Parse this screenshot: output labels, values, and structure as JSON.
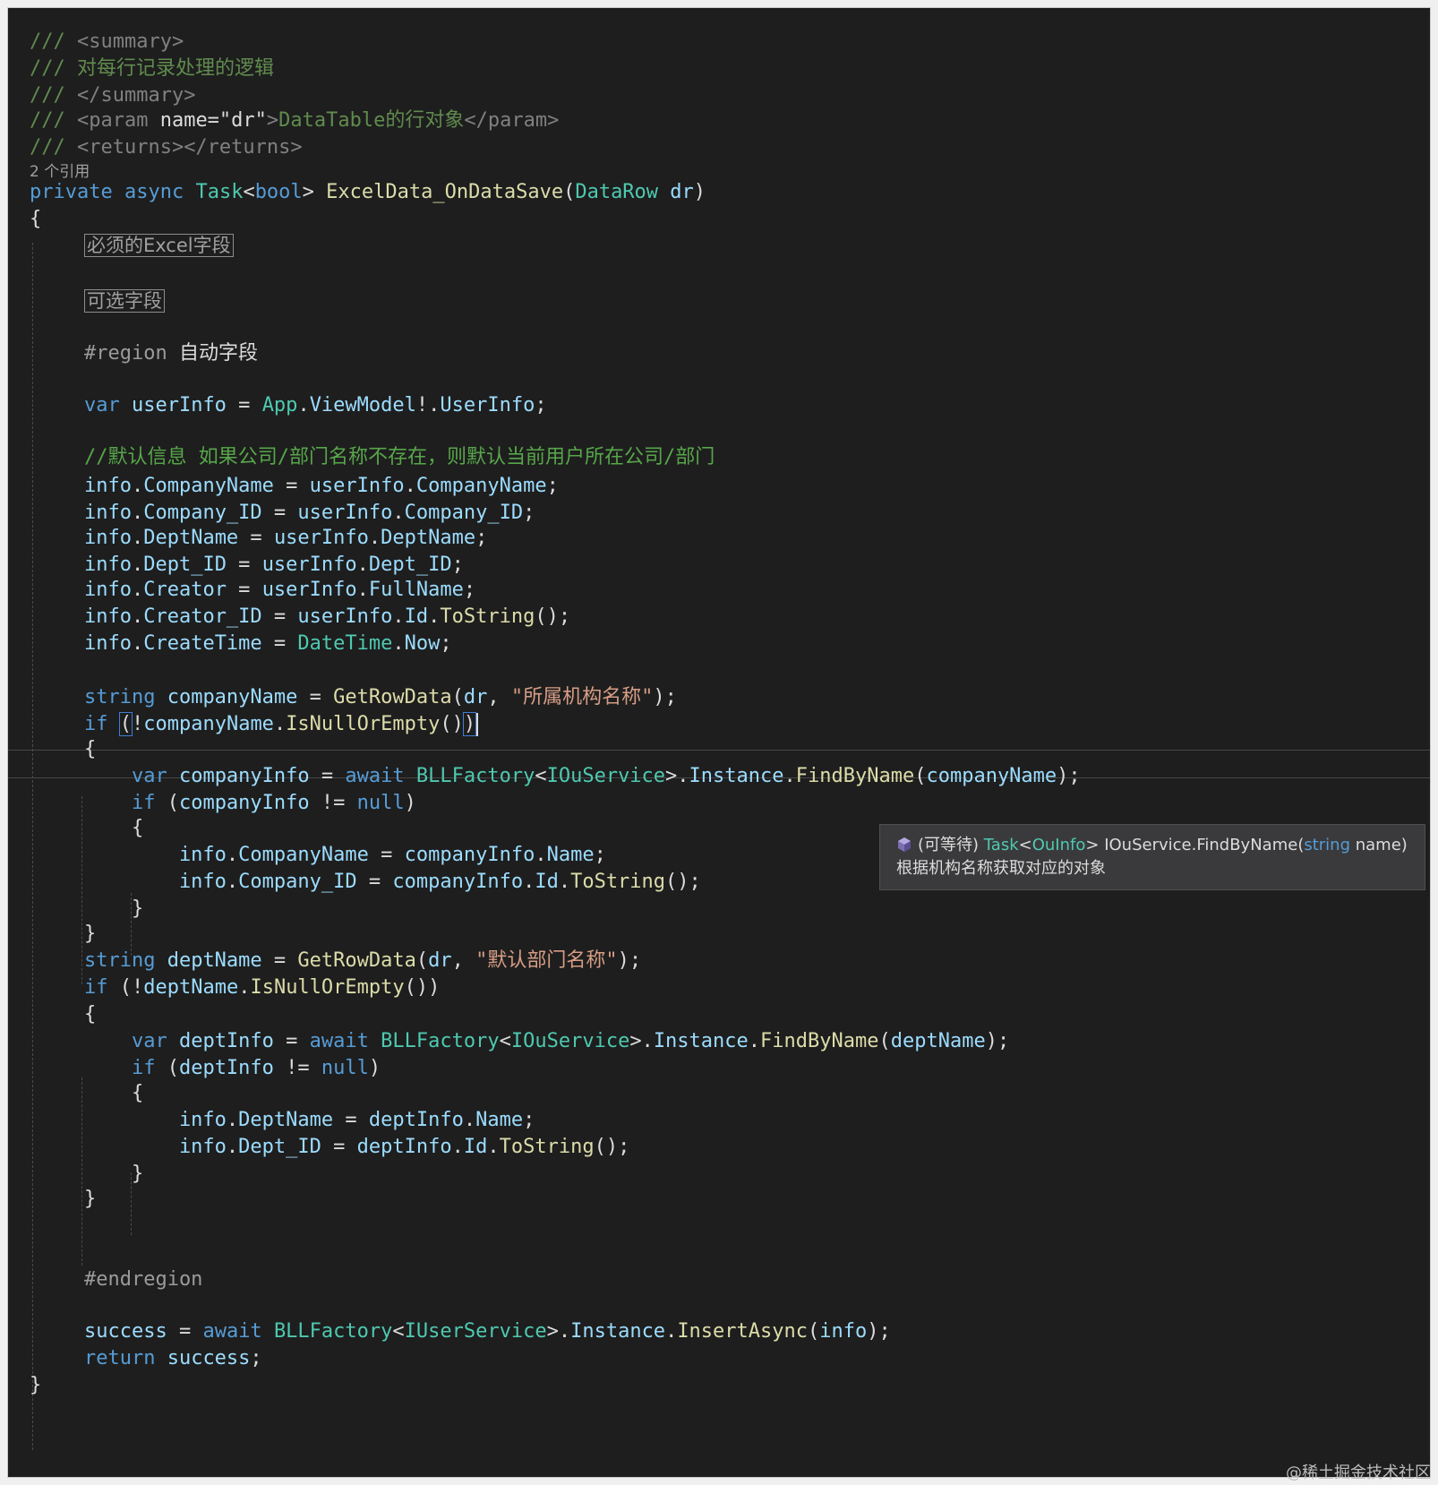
{
  "editor": {
    "codelens": "2 个引用",
    "tooltip": {
      "icon": "cube-icon",
      "prefix": "(可等待) ",
      "type": "Task",
      "lt": "<",
      "type_arg": "OuInfo",
      "gt": "> ",
      "method": "IOuService.FindByName(",
      "param_type": "string",
      "param_name": " name)",
      "description": "根据机构名称获取对应的对象"
    }
  },
  "lines": [
    [
      [
        "c-doc",
        "/// "
      ],
      [
        "c-doctag",
        "<summary>"
      ]
    ],
    [
      [
        "c-doc",
        "/// 对每行记录处理的逻辑"
      ]
    ],
    [
      [
        "c-doc",
        "/// "
      ],
      [
        "c-doctag",
        "</summary>"
      ]
    ],
    [
      [
        "c-doc",
        "/// "
      ],
      [
        "c-doctag",
        "<param "
      ],
      [
        "c-plain",
        "name=\"dr\""
      ],
      [
        "c-doctag",
        ">"
      ],
      [
        "c-doc",
        "DataTable的行对象"
      ],
      [
        "c-doctag",
        "</param>"
      ]
    ],
    [
      [
        "c-doc",
        "/// "
      ],
      [
        "c-doctag",
        "<returns></returns>"
      ]
    ],
    [
      [
        "c-kw",
        "private"
      ],
      [
        "c-plain",
        " "
      ],
      [
        "c-kw",
        "async"
      ],
      [
        "c-plain",
        " "
      ],
      [
        "c-type",
        "Task"
      ],
      [
        "c-plain",
        "<"
      ],
      [
        "c-kw",
        "bool"
      ],
      [
        "c-plain",
        "> "
      ],
      [
        "c-meth",
        "ExcelData_OnDataSave"
      ],
      [
        "c-plain",
        "("
      ],
      [
        "c-type",
        "DataRow"
      ],
      [
        "c-plain",
        " "
      ],
      [
        "c-var",
        "dr"
      ],
      [
        "c-plain",
        ")"
      ]
    ],
    [
      [
        "c-plain",
        "{"
      ]
    ],
    [
      [
        "c-plain",
        "    "
      ],
      [
        "collapsed",
        "必须的Excel字段"
      ]
    ],
    [
      [
        "c-plain",
        "    "
      ],
      [
        "collapsed",
        "可选字段"
      ]
    ],
    [
      [
        "c-pre",
        "    #region "
      ],
      [
        "c-plain",
        "自动字段"
      ]
    ],
    [
      [
        "c-kw",
        "    var"
      ],
      [
        "c-plain",
        " "
      ],
      [
        "c-var",
        "userInfo"
      ],
      [
        "c-plain",
        " = "
      ],
      [
        "c-type",
        "App"
      ],
      [
        "c-plain",
        "."
      ],
      [
        "c-var",
        "ViewModel"
      ],
      [
        "c-plain",
        "!."
      ],
      [
        "c-var",
        "UserInfo"
      ],
      [
        "c-plain",
        ";"
      ]
    ],
    [
      [
        "c-cmt",
        "    //默认信息 如果公司/部门名称不存在，则默认当前用户所在公司/部门"
      ]
    ],
    [
      [
        "c-var",
        "    info"
      ],
      [
        "c-plain",
        "."
      ],
      [
        "c-var",
        "CompanyName"
      ],
      [
        "c-plain",
        " = "
      ],
      [
        "c-var",
        "userInfo"
      ],
      [
        "c-plain",
        "."
      ],
      [
        "c-var",
        "CompanyName"
      ],
      [
        "c-plain",
        ";"
      ]
    ],
    [
      [
        "c-var",
        "    info"
      ],
      [
        "c-plain",
        "."
      ],
      [
        "c-var",
        "Company_ID"
      ],
      [
        "c-plain",
        " = "
      ],
      [
        "c-var",
        "userInfo"
      ],
      [
        "c-plain",
        "."
      ],
      [
        "c-var",
        "Company_ID"
      ],
      [
        "c-plain",
        ";"
      ]
    ],
    [
      [
        "c-var",
        "    info"
      ],
      [
        "c-plain",
        "."
      ],
      [
        "c-var",
        "DeptName"
      ],
      [
        "c-plain",
        " = "
      ],
      [
        "c-var",
        "userInfo"
      ],
      [
        "c-plain",
        "."
      ],
      [
        "c-var",
        "DeptName"
      ],
      [
        "c-plain",
        ";"
      ]
    ],
    [
      [
        "c-var",
        "    info"
      ],
      [
        "c-plain",
        "."
      ],
      [
        "c-var",
        "Dept_ID"
      ],
      [
        "c-plain",
        " = "
      ],
      [
        "c-var",
        "userInfo"
      ],
      [
        "c-plain",
        "."
      ],
      [
        "c-var",
        "Dept_ID"
      ],
      [
        "c-plain",
        ";"
      ]
    ],
    [
      [
        "c-var",
        "    info"
      ],
      [
        "c-plain",
        "."
      ],
      [
        "c-var",
        "Creator"
      ],
      [
        "c-plain",
        " = "
      ],
      [
        "c-var",
        "userInfo"
      ],
      [
        "c-plain",
        "."
      ],
      [
        "c-var",
        "FullName"
      ],
      [
        "c-plain",
        ";"
      ]
    ],
    [
      [
        "c-var",
        "    info"
      ],
      [
        "c-plain",
        "."
      ],
      [
        "c-var",
        "Creator_ID"
      ],
      [
        "c-plain",
        " = "
      ],
      [
        "c-var",
        "userInfo"
      ],
      [
        "c-plain",
        "."
      ],
      [
        "c-var",
        "Id"
      ],
      [
        "c-plain",
        "."
      ],
      [
        "c-meth",
        "ToString"
      ],
      [
        "c-plain",
        "();"
      ]
    ],
    [
      [
        "c-var",
        "    info"
      ],
      [
        "c-plain",
        "."
      ],
      [
        "c-var",
        "CreateTime"
      ],
      [
        "c-plain",
        " = "
      ],
      [
        "c-type",
        "DateTime"
      ],
      [
        "c-plain",
        "."
      ],
      [
        "c-var",
        "Now"
      ],
      [
        "c-plain",
        ";"
      ]
    ],
    [
      [
        "c-kw",
        "    string"
      ],
      [
        "c-plain",
        " "
      ],
      [
        "c-var",
        "companyName"
      ],
      [
        "c-plain",
        " = "
      ],
      [
        "c-meth",
        "GetRowData"
      ],
      [
        "c-plain",
        "("
      ],
      [
        "c-var",
        "dr"
      ],
      [
        "c-plain",
        ", "
      ],
      [
        "c-str",
        "\"所属机构名称\""
      ],
      [
        "c-plain",
        ");"
      ]
    ],
    [
      [
        "c-kw",
        "    if"
      ],
      [
        "c-plain",
        " "
      ],
      [
        "c-brace-hl",
        "("
      ],
      [
        "c-plain",
        "!"
      ],
      [
        "c-var",
        "companyName"
      ],
      [
        "c-plain",
        "."
      ],
      [
        "c-meth",
        "IsNullOrEmpty"
      ],
      [
        "c-plain",
        "()"
      ],
      [
        "c-brace-hl",
        ")"
      ],
      [
        "cursor",
        ""
      ]
    ],
    [
      [
        "c-plain",
        "    {"
      ]
    ],
    [
      [
        "c-kw",
        "        var"
      ],
      [
        "c-plain",
        " "
      ],
      [
        "c-var",
        "companyInfo"
      ],
      [
        "c-plain",
        " = "
      ],
      [
        "c-kw",
        "await"
      ],
      [
        "c-plain",
        " "
      ],
      [
        "c-type",
        "BLLFactory"
      ],
      [
        "c-plain",
        "<"
      ],
      [
        "c-type",
        "IOuService"
      ],
      [
        "c-plain",
        ">."
      ],
      [
        "c-var",
        "Instance"
      ],
      [
        "c-plain",
        "."
      ],
      [
        "c-meth",
        "FindByName"
      ],
      [
        "c-plain",
        "("
      ],
      [
        "c-var",
        "companyName"
      ],
      [
        "c-plain",
        ");"
      ]
    ],
    [
      [
        "c-kw",
        "        if"
      ],
      [
        "c-plain",
        " ("
      ],
      [
        "c-var",
        "companyInfo"
      ],
      [
        "c-plain",
        " != "
      ],
      [
        "c-kw",
        "null"
      ],
      [
        "c-plain",
        ")"
      ]
    ],
    [
      [
        "c-plain",
        "        {"
      ]
    ],
    [
      [
        "c-var",
        "            info"
      ],
      [
        "c-plain",
        "."
      ],
      [
        "c-var",
        "CompanyName"
      ],
      [
        "c-plain",
        " = "
      ],
      [
        "c-var",
        "companyInfo"
      ],
      [
        "c-plain",
        "."
      ],
      [
        "c-var",
        "Name"
      ],
      [
        "c-plain",
        ";"
      ]
    ],
    [
      [
        "c-var",
        "            info"
      ],
      [
        "c-plain",
        "."
      ],
      [
        "c-var",
        "Company_ID"
      ],
      [
        "c-plain",
        " = "
      ],
      [
        "c-var",
        "companyInfo"
      ],
      [
        "c-plain",
        "."
      ],
      [
        "c-var",
        "Id"
      ],
      [
        "c-plain",
        "."
      ],
      [
        "c-meth",
        "ToString"
      ],
      [
        "c-plain",
        "();"
      ]
    ],
    [
      [
        "c-plain",
        "        }"
      ]
    ],
    [
      [
        "c-plain",
        "    }"
      ]
    ],
    [
      [
        "c-kw",
        "    string"
      ],
      [
        "c-plain",
        " "
      ],
      [
        "c-var",
        "deptName"
      ],
      [
        "c-plain",
        " = "
      ],
      [
        "c-meth",
        "GetRowData"
      ],
      [
        "c-plain",
        "("
      ],
      [
        "c-var",
        "dr"
      ],
      [
        "c-plain",
        ", "
      ],
      [
        "c-str",
        "\"默认部门名称\""
      ],
      [
        "c-plain",
        ");"
      ]
    ],
    [
      [
        "c-kw",
        "    if"
      ],
      [
        "c-plain",
        " (!"
      ],
      [
        "c-var",
        "deptName"
      ],
      [
        "c-plain",
        "."
      ],
      [
        "c-meth",
        "IsNullOrEmpty"
      ],
      [
        "c-plain",
        "())"
      ]
    ],
    [
      [
        "c-plain",
        "    {"
      ]
    ],
    [
      [
        "c-kw",
        "        var"
      ],
      [
        "c-plain",
        " "
      ],
      [
        "c-var",
        "deptInfo"
      ],
      [
        "c-plain",
        " = "
      ],
      [
        "c-kw",
        "await"
      ],
      [
        "c-plain",
        " "
      ],
      [
        "c-type",
        "BLLFactory"
      ],
      [
        "c-plain",
        "<"
      ],
      [
        "c-type",
        "IOuService"
      ],
      [
        "c-plain",
        ">."
      ],
      [
        "c-var",
        "Instance"
      ],
      [
        "c-plain",
        "."
      ],
      [
        "c-meth",
        "FindByName"
      ],
      [
        "c-plain",
        "("
      ],
      [
        "c-var",
        "deptName"
      ],
      [
        "c-plain",
        ");"
      ]
    ],
    [
      [
        "c-kw",
        "        if"
      ],
      [
        "c-plain",
        " ("
      ],
      [
        "c-var",
        "deptInfo"
      ],
      [
        "c-plain",
        " != "
      ],
      [
        "c-kw",
        "null"
      ],
      [
        "c-plain",
        ")"
      ]
    ],
    [
      [
        "c-plain",
        "        {"
      ]
    ],
    [
      [
        "c-var",
        "            info"
      ],
      [
        "c-plain",
        "."
      ],
      [
        "c-var",
        "DeptName"
      ],
      [
        "c-plain",
        " = "
      ],
      [
        "c-var",
        "deptInfo"
      ],
      [
        "c-plain",
        "."
      ],
      [
        "c-var",
        "Name"
      ],
      [
        "c-plain",
        ";"
      ]
    ],
    [
      [
        "c-var",
        "            info"
      ],
      [
        "c-plain",
        "."
      ],
      [
        "c-var",
        "Dept_ID"
      ],
      [
        "c-plain",
        " = "
      ],
      [
        "c-var",
        "deptInfo"
      ],
      [
        "c-plain",
        "."
      ],
      [
        "c-var",
        "Id"
      ],
      [
        "c-plain",
        "."
      ],
      [
        "c-meth",
        "ToString"
      ],
      [
        "c-plain",
        "();"
      ]
    ],
    [
      [
        "c-plain",
        "        }"
      ]
    ],
    [
      [
        "c-plain",
        "    }"
      ]
    ],
    [
      [
        "c-pre",
        "    #endregion"
      ]
    ],
    [
      [
        "c-var",
        "    success"
      ],
      [
        "c-plain",
        " = "
      ],
      [
        "c-kw",
        "await"
      ],
      [
        "c-plain",
        " "
      ],
      [
        "c-type",
        "BLLFactory"
      ],
      [
        "c-plain",
        "<"
      ],
      [
        "c-type",
        "IUserService"
      ],
      [
        "c-plain",
        ">."
      ],
      [
        "c-var",
        "Instance"
      ],
      [
        "c-plain",
        "."
      ],
      [
        "c-meth",
        "InsertAsync"
      ],
      [
        "c-plain",
        "("
      ],
      [
        "c-var",
        "info"
      ],
      [
        "c-plain",
        ");"
      ]
    ],
    [
      [
        "c-kw",
        "    return"
      ],
      [
        "c-plain",
        " "
      ],
      [
        "c-var",
        "success"
      ],
      [
        "c-plain",
        ";"
      ]
    ],
    [
      [
        "c-plain",
        "}"
      ]
    ]
  ],
  "watermark": "@稀土掘金技术社区"
}
